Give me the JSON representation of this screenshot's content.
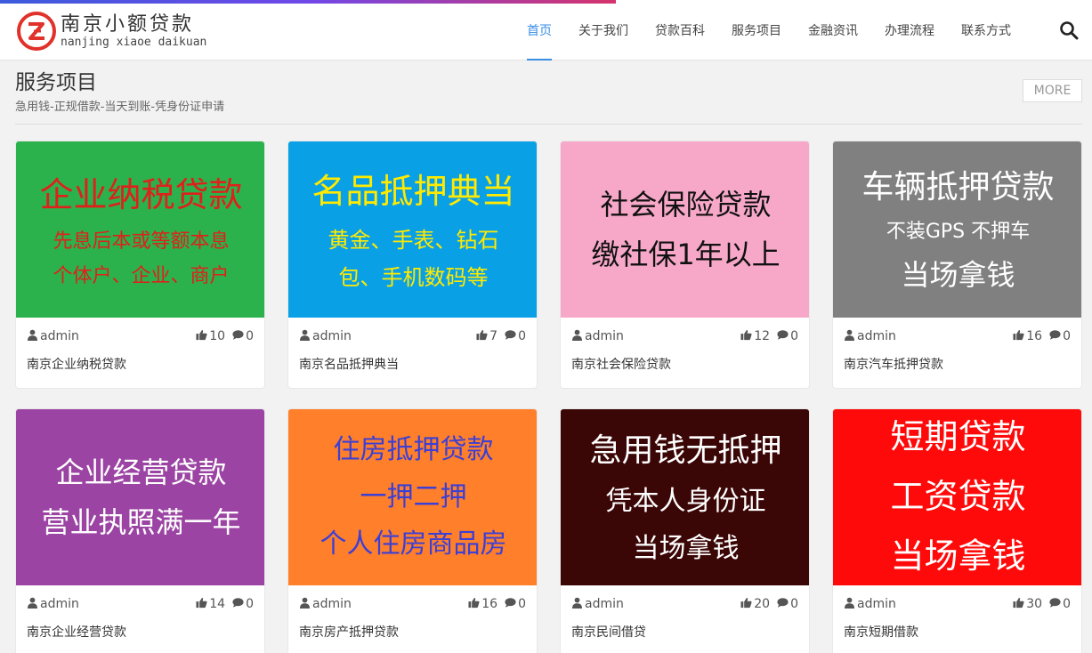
{
  "header": {
    "logo_cn": "南京小额贷款",
    "logo_en": "nanjing xiaoe daikuan",
    "nav": [
      {
        "id": "home",
        "label": "首页"
      },
      {
        "id": "about",
        "label": "关于我们"
      },
      {
        "id": "encyclopedia",
        "label": "贷款百科"
      },
      {
        "id": "services",
        "label": "服务项目"
      },
      {
        "id": "news",
        "label": "金融资讯"
      },
      {
        "id": "process",
        "label": "办理流程"
      },
      {
        "id": "contact",
        "label": "联系方式"
      }
    ],
    "active_nav": "home",
    "accent_color": "#3a8ee6"
  },
  "section": {
    "title": "服务项目",
    "subtitle": "急用钱-正规借款-当天到账-凭身份证申请",
    "more_label": "MORE"
  },
  "cards": [
    {
      "bg": "#2bb24c",
      "font": "serif",
      "lines": [
        {
          "text": "企业纳税贷款",
          "color": "#e0201a",
          "size": 38
        },
        {
          "text": "先息后本或等额本息",
          "color": "#e0201a",
          "size": 22
        },
        {
          "text": "个体户、企业、商户",
          "color": "#e0201a",
          "size": 22
        }
      ],
      "author": "admin",
      "likes": "10",
      "comments": "0",
      "title": "南京企业纳税贷款"
    },
    {
      "bg": "#0aa0e6",
      "font": "sans",
      "lines": [
        {
          "text": "名品抵押典当",
          "color": "#ffea00",
          "size": 38
        },
        {
          "text": "黄金、手表、钻石",
          "color": "#ffea00",
          "size": 24
        },
        {
          "text": "包、手机数码等",
          "color": "#ffea00",
          "size": 24
        }
      ],
      "author": "admin",
      "likes": "7",
      "comments": "0",
      "title": "南京名品抵押典当"
    },
    {
      "bg": "#f7a8c8",
      "font": "sans",
      "lines": [
        {
          "text": "社会保险贷款",
          "color": "#111111",
          "size": 32
        },
        {
          "text": "缴社保1年以上",
          "color": "#111111",
          "size": 32
        }
      ],
      "author": "admin",
      "likes": "12",
      "comments": "0",
      "title": "南京社会保险贷款"
    },
    {
      "bg": "#808080",
      "font": "sans",
      "lines": [
        {
          "text": "车辆抵押贷款",
          "color": "#ffffff",
          "size": 36
        },
        {
          "text": "不装GPS 不押车",
          "color": "#ffffff",
          "size": 22
        },
        {
          "text": "当场拿钱",
          "color": "#ffffff",
          "size": 32
        }
      ],
      "author": "admin",
      "likes": "16",
      "comments": "0",
      "title": "南京汽车抵押贷款"
    },
    {
      "bg": "#9b44a3",
      "font": "sans",
      "lines": [
        {
          "text": "企业经营贷款",
          "color": "#ffffff",
          "size": 32
        },
        {
          "text": "营业执照满一年",
          "color": "#ffffff",
          "size": 32
        }
      ],
      "author": "admin",
      "likes": "14",
      "comments": "0",
      "title": "南京企业经营贷款"
    },
    {
      "bg": "#ff7f2a",
      "font": "serif",
      "lines": [
        {
          "text": "住房抵押贷款",
          "color": "#3b3fd6",
          "size": 30
        },
        {
          "text": "一押二押",
          "color": "#3b3fd6",
          "size": 30
        },
        {
          "text": "个人住房商品房",
          "color": "#3b3fd6",
          "size": 30
        }
      ],
      "author": "admin",
      "likes": "16",
      "comments": "0",
      "title": "南京房产抵押贷款"
    },
    {
      "bg": "#3b0606",
      "font": "sans",
      "lines": [
        {
          "text": "急用钱无抵押",
          "color": "#ffffff",
          "size": 36
        },
        {
          "text": "凭本人身份证",
          "color": "#ffffff",
          "size": 30
        },
        {
          "text": "当场拿钱",
          "color": "#ffffff",
          "size": 30
        }
      ],
      "author": "admin",
      "likes": "20",
      "comments": "0",
      "title": "南京民间借贷"
    },
    {
      "bg": "#ff0a0a",
      "font": "sans",
      "lines": [
        {
          "text": "短期贷款",
          "color": "#ffffff",
          "size": 38
        },
        {
          "text": "工资贷款",
          "color": "#ffffff",
          "size": 38
        },
        {
          "text": "当场拿钱",
          "color": "#ffffff",
          "size": 38
        }
      ],
      "author": "admin",
      "likes": "30",
      "comments": "0",
      "title": "南京短期借款"
    }
  ],
  "icons": {
    "user": "user-icon",
    "like": "thumbs-up-icon",
    "comment": "comment-icon",
    "search": "search-icon"
  }
}
